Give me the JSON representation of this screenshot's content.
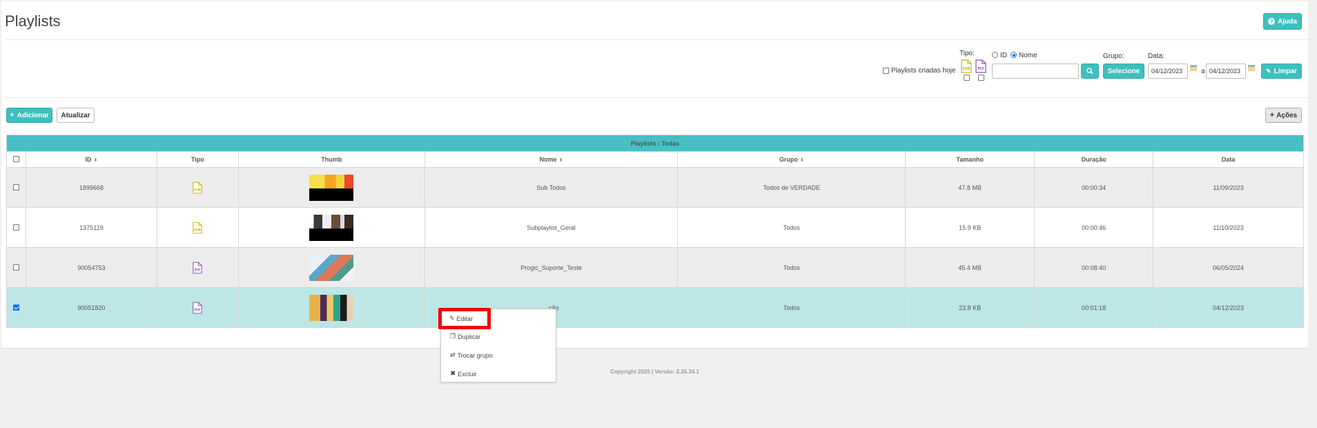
{
  "page": {
    "title": "Playlists"
  },
  "header": {
    "help_label": "Ajuda"
  },
  "filters": {
    "created_today_label": "Playlists criadas hoje",
    "tipo_label": "Tipo:",
    "tipo_options": [
      "SUB",
      "PLT"
    ],
    "search_by_id_label": "ID",
    "search_by_name_label": "Nome",
    "search_value": "",
    "group_label": "Grupo:",
    "group_button": "Selecione",
    "date_label": "Data:",
    "date_from": "04/12/2023",
    "date_sep": "a",
    "date_to": "04/12/2023",
    "clear_label": "Limpar"
  },
  "toolbar": {
    "add_label": "Adicionar",
    "refresh_label": "Atualizar",
    "actions_label": "Ações"
  },
  "table": {
    "caption": "Playlists : Todas",
    "columns": [
      "ID",
      "Tipo",
      "Thumb",
      "Nome",
      "Grupo",
      "Tamanho",
      "Duração",
      "Data"
    ],
    "rows": [
      {
        "id": "1899668",
        "tipo": "SUB",
        "nome": "Sub Todos",
        "grupo": "Todos de VERDADE",
        "tamanho": "47.8 MB",
        "duracao": "00:00:34",
        "data": "11/09/2023",
        "checked": false
      },
      {
        "id": "1375119",
        "tipo": "SUB",
        "nome": "Subplaylist_Geral",
        "grupo": "Todos",
        "tamanho": "15.9 KB",
        "duracao": "00:00:46",
        "data": "11/10/2023",
        "checked": false
      },
      {
        "id": "90054753",
        "tipo": "PLT",
        "nome": "Progic_Suporte_Teste",
        "grupo": "Todos",
        "tamanho": "45.4 MB",
        "duracao": "00:08:40",
        "data": "06/05/2024",
        "checked": false
      },
      {
        "id": "90051820",
        "tipo": "PLT",
        "nome": "...ção",
        "grupo": "Todos",
        "tamanho": "23.8 KB",
        "duracao": "00:01:18",
        "data": "04/12/2023",
        "checked": true
      }
    ]
  },
  "context_menu": {
    "items": [
      "Editar",
      "Duplicar",
      "Trocar grupo",
      "Excluir"
    ]
  },
  "footer": {
    "text": "Copyright 2025 | Versão: 2.26.34.1"
  },
  "colors": {
    "accent": "#3fbfbf",
    "selected_row": "#bde6e6",
    "highlight": "#f20000",
    "sub_icon": "#c9b800",
    "plt_icon": "#8a4fa6"
  }
}
